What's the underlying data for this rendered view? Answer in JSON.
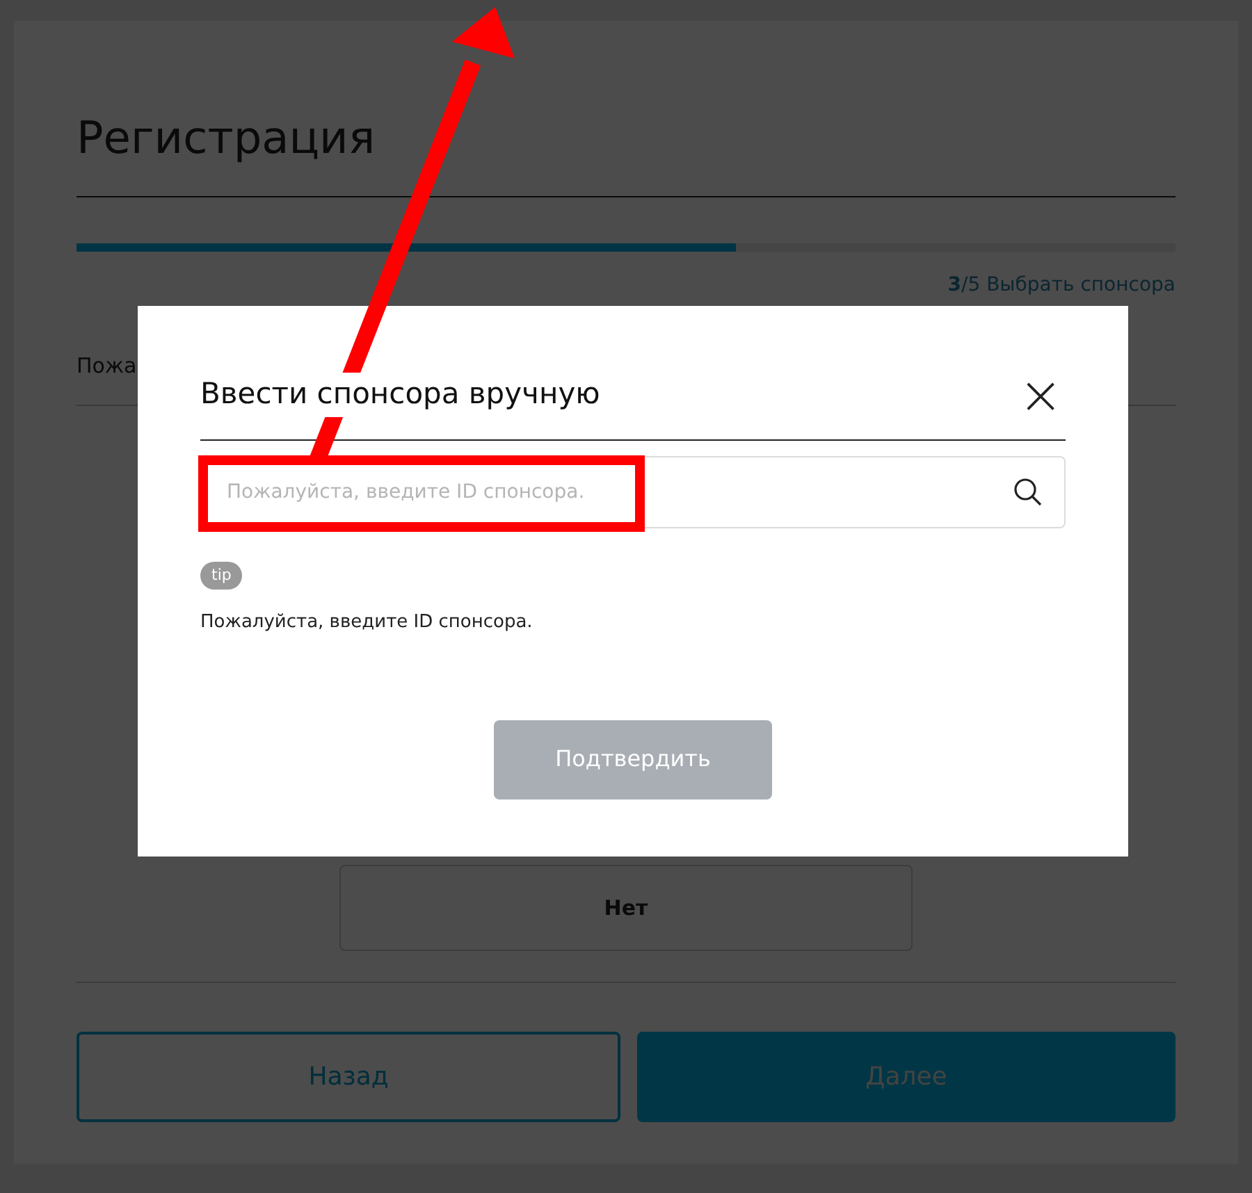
{
  "page": {
    "title": "Регистрация",
    "progress": {
      "level": 0.6
    },
    "step": "**3**/5 Выбрать спонсора",
    "prompt": "Пожа",
    "option": "Нет",
    "buttons": [
      {
        "label": "Назад",
        "kind": "outline"
      },
      {
        "label": "Далее",
        "kind": "primary"
      }
    ]
  },
  "dialog": {
    "title": "Ввести спонсора вручную",
    "close": "×",
    "search": {
      "placeholder": "Пожалуйста, введите ID спонсора."
    },
    "tip_badge": "tip",
    "tip_text": "Пожалуйста, введите ID спонсора.",
    "confirm": {
      "label": "Подтвердить",
      "disabled": true
    }
  }
}
